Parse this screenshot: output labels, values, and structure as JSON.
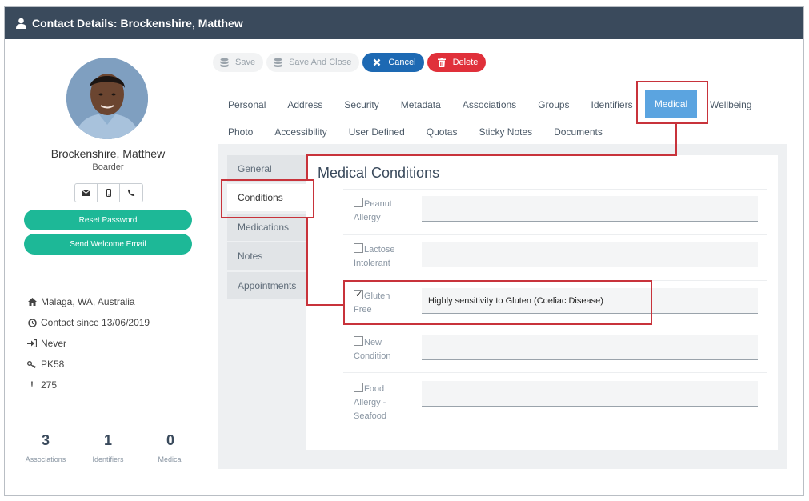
{
  "window": {
    "title": "Contact Details: Brockenshire, Matthew"
  },
  "profile": {
    "name": "Brockenshire, Matthew",
    "role": "Boarder",
    "reset_password": "Reset Password",
    "send_welcome": "Send Welcome Email",
    "location": "Malaga, WA, Australia",
    "contact_since": "Contact since 13/06/2019",
    "last_login": "Never",
    "key_code": "PK58",
    "alert_count": "275",
    "stats": [
      {
        "value": "3",
        "label": "Associations"
      },
      {
        "value": "1",
        "label": "Identifiers"
      },
      {
        "value": "0",
        "label": "Medical"
      }
    ]
  },
  "toolbar": {
    "save": "Save",
    "save_close": "Save And Close",
    "cancel": "Cancel",
    "delete": "Delete"
  },
  "tabs": {
    "row1": [
      "Personal",
      "Address",
      "Security",
      "Metadata",
      "Associations",
      "Groups",
      "Identifiers",
      "Medical",
      "Wellbeing"
    ],
    "row2": [
      "Photo",
      "Accessibility",
      "User Defined",
      "Quotas",
      "Sticky Notes",
      "Documents"
    ],
    "active": "Medical"
  },
  "subnav": {
    "items": [
      "General",
      "Conditions",
      "Medications",
      "Notes",
      "Appointments"
    ],
    "active": "Conditions"
  },
  "medical": {
    "title": "Medical Conditions",
    "conditions": [
      {
        "label": "Peanut Allergy",
        "checked": false,
        "note": ""
      },
      {
        "label": "Lactose Intolerant",
        "checked": false,
        "note": ""
      },
      {
        "label": "Gluten Free",
        "checked": true,
        "note": "Highly sensitivity to Gluten (Coeliac Disease)"
      },
      {
        "label": "New Condition",
        "checked": false,
        "note": ""
      },
      {
        "label": "Food Allergy - Seafood",
        "checked": false,
        "note": ""
      }
    ]
  },
  "colors": {
    "titlebar": "#3a4a5c",
    "accent_green": "#1db897",
    "cancel_blue": "#1d69b3",
    "delete_red": "#e0303a",
    "active_tab": "#5ba4e0",
    "highlight_red": "#c8333b"
  }
}
